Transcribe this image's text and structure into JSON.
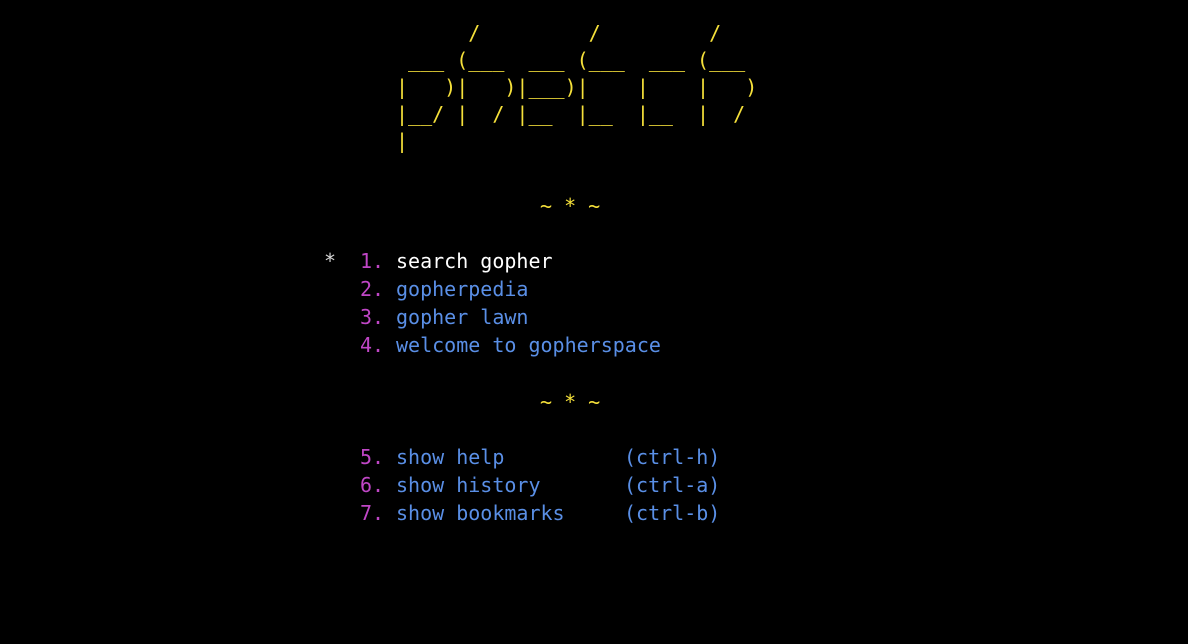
{
  "banner": {
    "lines": [
      "      /         /         /",
      " ___ (___  ___ (___  ___ (___",
      "|   )|   )|___)|    |    |   )",
      "|__/ |  / |__  |__  |__  |  /",
      "|"
    ]
  },
  "dividers": {
    "top": "~ * ~",
    "middle": "~ * ~"
  },
  "cursor": "*",
  "bookmarks": [
    {
      "number": "1.",
      "label": "search gopher",
      "selected": true
    },
    {
      "number": "2.",
      "label": "gopherpedia",
      "selected": false
    },
    {
      "number": "3.",
      "label": "gopher lawn",
      "selected": false
    },
    {
      "number": "4.",
      "label": "welcome to gopherspace",
      "selected": false
    }
  ],
  "commands": [
    {
      "number": "5.",
      "label": "show help",
      "shortcut": "(ctrl-h)"
    },
    {
      "number": "6.",
      "label": "show history",
      "shortcut": "(ctrl-a)"
    },
    {
      "number": "7.",
      "label": "show bookmarks",
      "shortcut": "(ctrl-b)"
    }
  ],
  "colors": {
    "background": "#000000",
    "banner": "#f5e03a",
    "number": "#c046c6",
    "link": "#5a8fe6",
    "selected": "#ffffff"
  }
}
